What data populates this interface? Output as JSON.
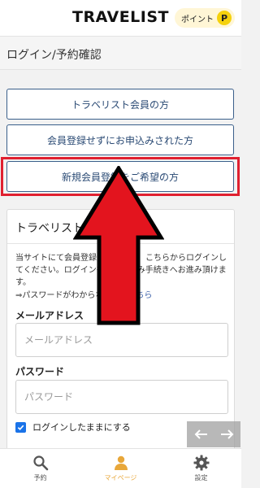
{
  "header": {
    "logo": "TRAVELIST",
    "points_label": "ポイント",
    "points_icon": "P"
  },
  "section_title": "ログイン/予約確認",
  "options": {
    "member": "トラベリスト会員の方",
    "guest": "会員登録せずにお申込みされた方",
    "new_member": "新規会員登録をご希望の方"
  },
  "login_card": {
    "title": "トラベリスト会員",
    "description": "当サイトにて会員登録済みの方は、こちらからログインしてください。ログイン後、お申込み手続きへお進み頂けます。",
    "forgot_prefix": "⇒パスワードがわからない方は",
    "forgot_link": "こちら",
    "email_label": "メールアドレス",
    "email_placeholder": "メールアドレス",
    "password_label": "パスワード",
    "password_placeholder": "パスワード",
    "remember_label": "ログインしたままにする"
  },
  "bottom_nav": {
    "reserve": "予約",
    "mypage": "マイページ",
    "settings": "設定"
  },
  "colors": {
    "accent": "#e8a73a",
    "highlight": "#e02030",
    "button_border": "#3a5f8a",
    "point_yellow": "#f5d10c"
  }
}
